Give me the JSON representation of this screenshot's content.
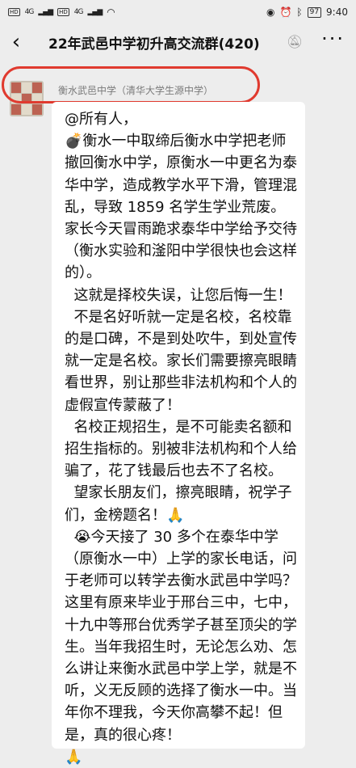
{
  "status_bar": {
    "hd1": "HD",
    "hd2": "HD",
    "net1": "4G",
    "net2": "4G",
    "battery": "97",
    "time": "9:40"
  },
  "header": {
    "back_icon": "chevron-left-icon",
    "title": "22年武邑中学初升高交流群(420)",
    "mute_icon": "bell-off-icon",
    "more_icon": "more-dots-icon"
  },
  "message": {
    "sender": "衡水武邑中学（清华大学生源中学）",
    "paragraphs": [
      "@所有人，",
      "💣衡水一中取缔后衡水中学把老师撤回衡水中学，原衡水一中更名为泰华中学，造成教学水平下滑，管理混乱，导致 1859 名学生学业荒废。家长今天冒雨跪求泰华中学给予交待（衡水实验和滏阳中学很快也会这样的）。",
      "  这就是择校失误，让您后悔一生！",
      "  不是名好听就一定是名校，名校靠的是口碑，不是到处吹牛，到处宣传就一定是名校。家长们需要擦亮眼睛看世界，别让那些非法机构和个人的虚假宣传蒙蔽了！",
      "  名校正规招生，是不可能卖名额和招生指标的。别被非法机构和个人给骗了，花了钱最后也去不了名校。",
      "  望家长朋友们，擦亮眼睛，祝学子们，金榜题名！🙏",
      "  😭今天接了 30 多个在泰华中学（原衡水一中）上学的家长电话，问于老师可以转学去衡水武邑中学吗？这里有原来毕业于邢台三中，七中，十九中等邢台优秀学子甚至顶尖的学生。当年我招生时，无论怎么劝、怎么讲让来衡水武邑中学上学，就是不听，义无反顾的选择了衡水一中。当年你不理我，今天你高攀不起！但是，真的很心疼！",
      "🙏"
    ]
  }
}
